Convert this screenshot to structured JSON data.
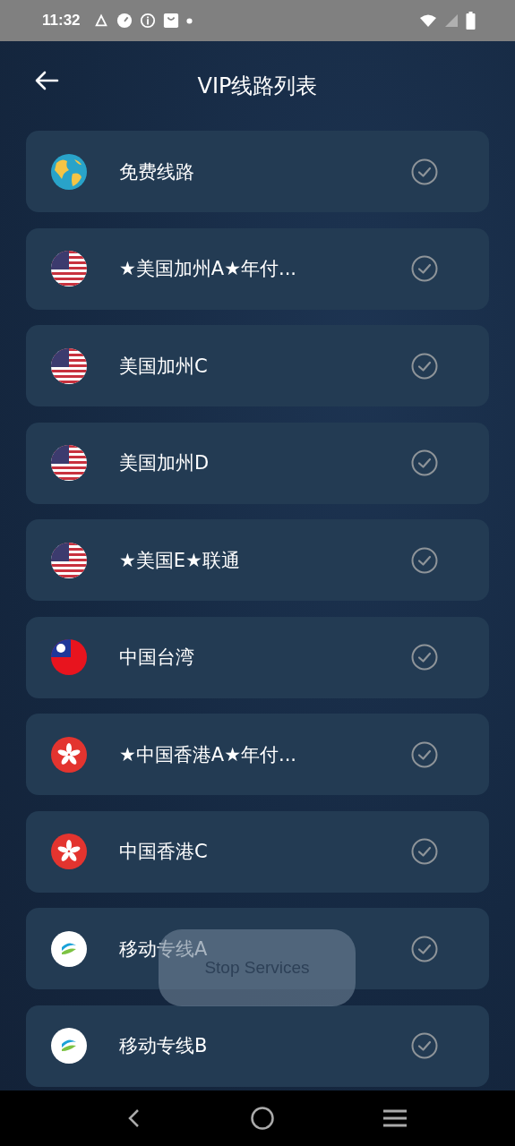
{
  "status_bar": {
    "time": "11:32"
  },
  "header": {
    "title": "VIP线路列表"
  },
  "lines": [
    {
      "name": "免费线路",
      "kind": "globe",
      "selected": false
    },
    {
      "name": "★美国加州A★年付...",
      "kind": "us",
      "selected": false
    },
    {
      "name": "美国加州C",
      "kind": "us",
      "selected": false
    },
    {
      "name": "美国加州D",
      "kind": "us",
      "selected": false
    },
    {
      "name": "★美国E★联通",
      "kind": "us",
      "selected": false
    },
    {
      "name": "中国台湾",
      "kind": "tw",
      "selected": false
    },
    {
      "name": "★中国香港A★年付...",
      "kind": "hk",
      "selected": false
    },
    {
      "name": "中国香港C",
      "kind": "hk",
      "selected": false
    },
    {
      "name": "移动专线A",
      "kind": "mobile",
      "selected": false
    },
    {
      "name": "移动专线B",
      "kind": "mobile",
      "selected": false
    }
  ],
  "toast": {
    "text": "Stop Services"
  }
}
